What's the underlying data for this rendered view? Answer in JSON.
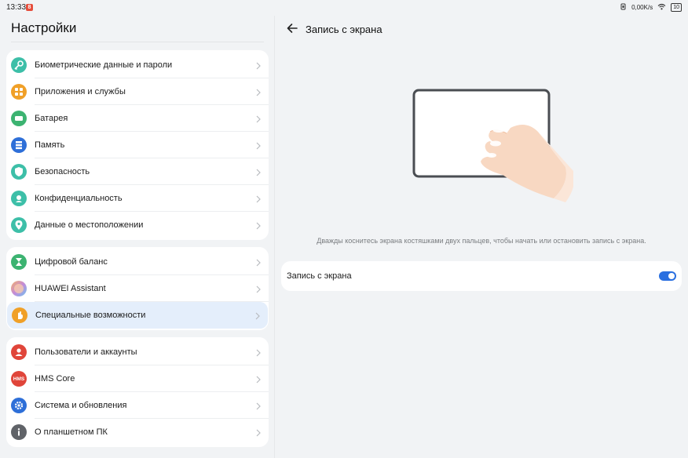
{
  "status_bar": {
    "time": "13:33",
    "badge": "8",
    "network_speed": "0,00K/s",
    "battery": "10"
  },
  "settings": {
    "title": "Настройки",
    "groups": [
      {
        "items": [
          {
            "label": "Биометрические данные и пароли",
            "icon": "key-icon",
            "color": "#3dbfa8"
          },
          {
            "label": "Приложения и службы",
            "icon": "apps-icon",
            "color": "#f0a028"
          },
          {
            "label": "Батарея",
            "icon": "battery-icon",
            "color": "#3cb371"
          },
          {
            "label": "Память",
            "icon": "storage-icon",
            "color": "#2e6fd8"
          },
          {
            "label": "Безопасность",
            "icon": "shield-icon",
            "color": "#3dbfa8"
          },
          {
            "label": "Конфиденциальность",
            "icon": "privacy-icon",
            "color": "#3dbfa8"
          },
          {
            "label": "Данные о местоположении",
            "icon": "location-icon",
            "color": "#3dbfa8"
          }
        ]
      },
      {
        "items": [
          {
            "label": "Цифровой баланс",
            "icon": "hourglass-icon",
            "color": "#3cb371"
          },
          {
            "label": "HUAWEI Assistant",
            "icon": "assistant-icon",
            "color": "#c58ad8"
          },
          {
            "label": "Специальные возможности",
            "icon": "hand-icon",
            "color": "#f0a028",
            "selected": true
          }
        ]
      },
      {
        "items": [
          {
            "label": "Пользователи и аккаунты",
            "icon": "user-icon",
            "color": "#e0453a"
          },
          {
            "label": "HMS Core",
            "icon": "hms-icon",
            "color": "#e0453a",
            "icon_text": "HMS"
          },
          {
            "label": "Система и обновления",
            "icon": "gear-icon",
            "color": "#2e6fd8"
          },
          {
            "label": "О планшетном ПК",
            "icon": "info-icon",
            "color": "#606368"
          }
        ]
      }
    ]
  },
  "detail": {
    "title": "Запись с экрана",
    "description": "Дважды коснитесь экрана костяшками двух пальцев, чтобы начать или остановить запись с экрана.",
    "toggle_label": "Запись с экрана",
    "toggle_on": true,
    "accent": "#2a6fe0"
  }
}
